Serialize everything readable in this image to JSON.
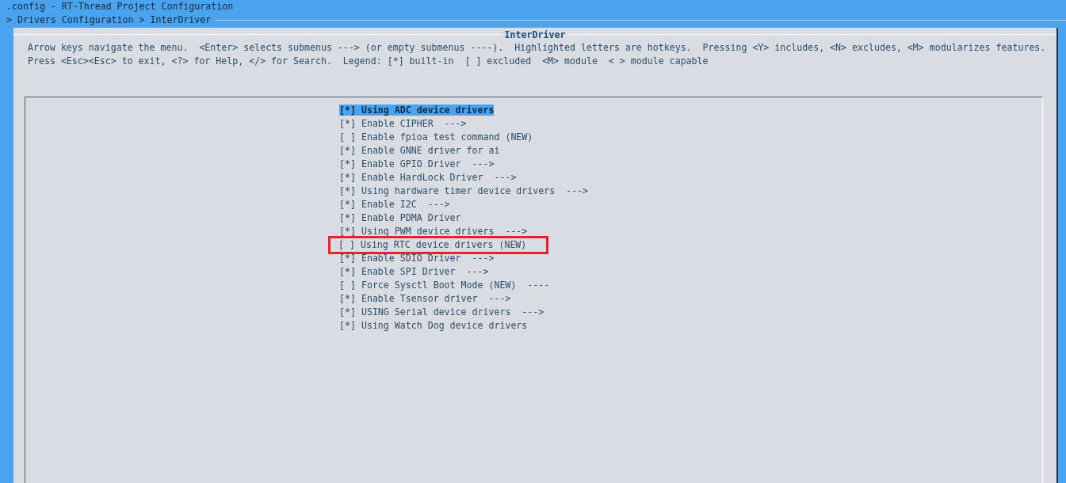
{
  "window": {
    "title": ".config - RT-Thread Project Configuration"
  },
  "breadcrumb": "> Drivers Configuration > InterDriver",
  "dialog": {
    "title": "InterDriver",
    "help_lines": [
      "Arrow keys navigate the menu.  <Enter> selects submenus ---> (or empty submenus ----).  Highlighted letters are hotkeys.  Pressing <Y> includes, <N> excludes, <M> modularizes features.",
      "Press <Esc><Esc> to exit, <?> for Help, </> for Search.  Legend: [*] built-in  [ ] excluded  <M> module  < > module capable"
    ]
  },
  "menu": [
    {
      "mark": "[*]",
      "label": "Using ADC device drivers",
      "selected": true,
      "outlined": false
    },
    {
      "mark": "[*]",
      "label": "Enable CIPHER  --->",
      "selected": false,
      "outlined": false
    },
    {
      "mark": "[ ]",
      "label": "Enable fpioa test command (NEW)",
      "selected": false,
      "outlined": false
    },
    {
      "mark": "[*]",
      "label": "Enable GNNE driver for ai",
      "selected": false,
      "outlined": false
    },
    {
      "mark": "[*]",
      "label": "Enable GPIO Driver  --->",
      "selected": false,
      "outlined": false
    },
    {
      "mark": "[*]",
      "label": "Enable HardLock Driver  --->",
      "selected": false,
      "outlined": false
    },
    {
      "mark": "[*]",
      "label": "Using hardware timer device drivers  --->",
      "selected": false,
      "outlined": false
    },
    {
      "mark": "[*]",
      "label": "Enable I2C  --->",
      "selected": false,
      "outlined": false
    },
    {
      "mark": "[*]",
      "label": "Enable PDMA Driver",
      "selected": false,
      "outlined": false
    },
    {
      "mark": "[*]",
      "label": "Using PWM device drivers  --->",
      "selected": false,
      "outlined": false
    },
    {
      "mark": "[ ]",
      "label": "Using RTC device drivers (NEW)",
      "selected": false,
      "outlined": true
    },
    {
      "mark": "[*]",
      "label": "Enable SDIO Driver  --->",
      "selected": false,
      "outlined": false
    },
    {
      "mark": "[*]",
      "label": "Enable SPI Driver  --->",
      "selected": false,
      "outlined": false
    },
    {
      "mark": "[ ]",
      "label": "Force Sysctl Boot Mode (NEW)  ----",
      "selected": false,
      "outlined": false
    },
    {
      "mark": "[*]",
      "label": "Enable Tsensor driver  --->",
      "selected": false,
      "outlined": false
    },
    {
      "mark": "[*]",
      "label": "USING Serial device drivers  --->",
      "selected": false,
      "outlined": false
    },
    {
      "mark": "[*]",
      "label": "Using Watch Dog device drivers",
      "selected": false,
      "outlined": false
    }
  ]
}
